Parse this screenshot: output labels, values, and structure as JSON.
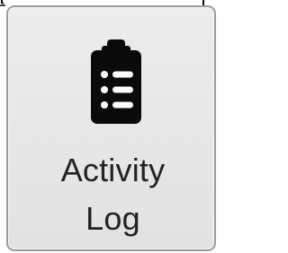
{
  "tile": {
    "label_line1": "Activity",
    "label_line2": "Log",
    "icon": "clipboard-list-icon"
  },
  "colors": {
    "tile_background": "#e6e6e6",
    "tile_border": "#9c9c9c",
    "icon": "#0a0a0a",
    "text": "#222222"
  }
}
